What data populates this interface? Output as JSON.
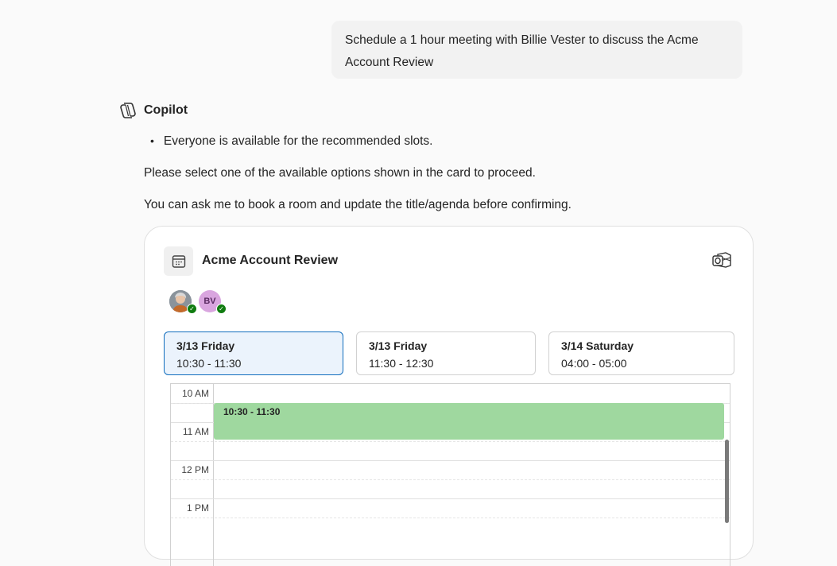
{
  "user_message": "Schedule a 1 hour meeting with Billie Vester to discuss the Acme Account Review",
  "assistant": {
    "name": "Copilot",
    "bullet": "Everyone is available for the recommended slots.",
    "paragraph_1": "Please select one of the available options shown in the card to proceed.",
    "paragraph_2": "You can ask me to book a room and update the title/agenda before confirming."
  },
  "card": {
    "title": "Acme Account Review",
    "attendees": [
      {
        "type": "photo",
        "status": "available"
      },
      {
        "initials": "BV",
        "status": "available"
      }
    ],
    "slots": [
      {
        "date": "3/13 Friday",
        "time": "10:30 - 11:30",
        "selected": true
      },
      {
        "date": "3/13 Friday",
        "time": "11:30 - 12:30",
        "selected": false
      },
      {
        "date": "3/14 Saturday",
        "time": "04:00 - 05:00",
        "selected": false
      }
    ],
    "timeline": {
      "hours": [
        "10 AM",
        "11 AM",
        "12 PM",
        "1 PM"
      ],
      "event_label": "10:30 - 11:30",
      "event_color": "#9fd89f"
    },
    "icons": {
      "calendar": "calendar-icon",
      "outlook": "outlook-icon"
    }
  },
  "colors": {
    "accent": "#0f6cbd",
    "selected_bg": "#ebf3fc",
    "available": "#107c10"
  }
}
